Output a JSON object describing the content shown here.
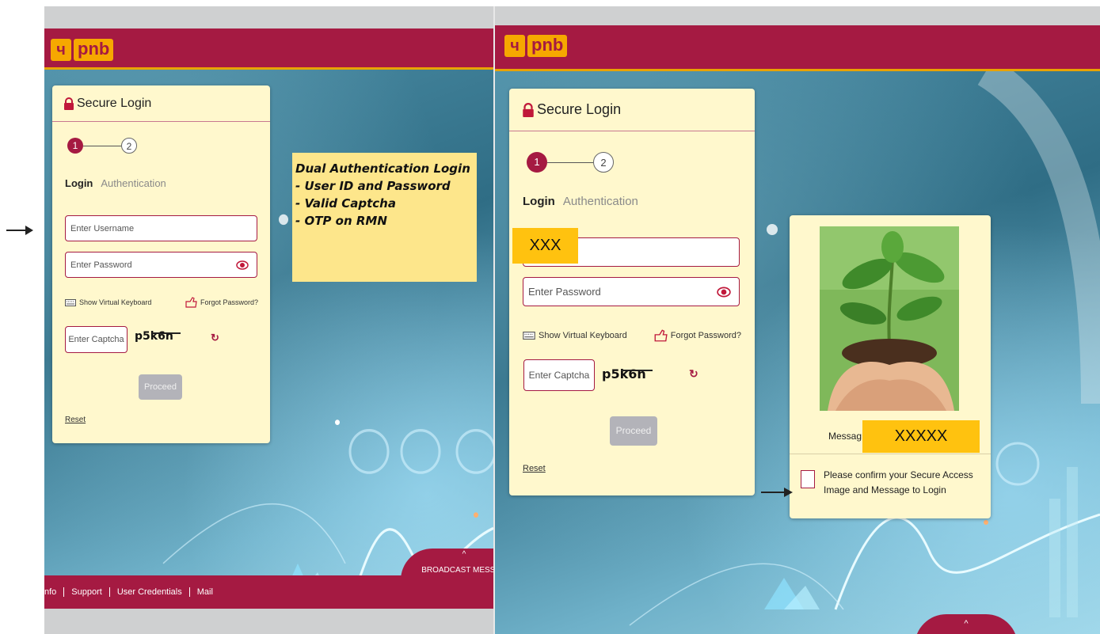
{
  "brand": {
    "logo_mark": "ч",
    "logo_text": "pnb"
  },
  "login_form": {
    "title": "Secure Login",
    "steps": [
      "1",
      "2"
    ],
    "tab_login": "Login",
    "tab_authentication": "Authentication",
    "username_placeholder": "Enter Username",
    "password_placeholder": "Enter Password",
    "virtual_keyboard": "Show Virtual Keyboard",
    "forgot_password": "Forgot Password?",
    "captcha_placeholder": "Enter Captcha",
    "captcha_code": "p5k6n",
    "refresh_symbol": "↻",
    "proceed": "Proceed",
    "reset": "Reset"
  },
  "annotation": {
    "lines": [
      "Dual Authentication Login",
      "- User ID and Password",
      "- Valid Captcha",
      "- OTP on RMN"
    ]
  },
  "footer": {
    "links": [
      "nfo",
      "Support",
      "User Credentials",
      "Mail"
    ],
    "broadcast": "BROADCAST MESSAG",
    "caret": "^"
  },
  "right_panel": {
    "username_redacted": "XXX",
    "secure_access": {
      "message_label": "Messag",
      "message_redacted": "XXXXX",
      "confirm_text": "Please confirm your Secure Access Image and Message to Login"
    }
  },
  "colors": {
    "brand": "#a51a42",
    "accent": "#f6a800",
    "card": "#fff8cd",
    "highlight": "#ffc20f"
  }
}
